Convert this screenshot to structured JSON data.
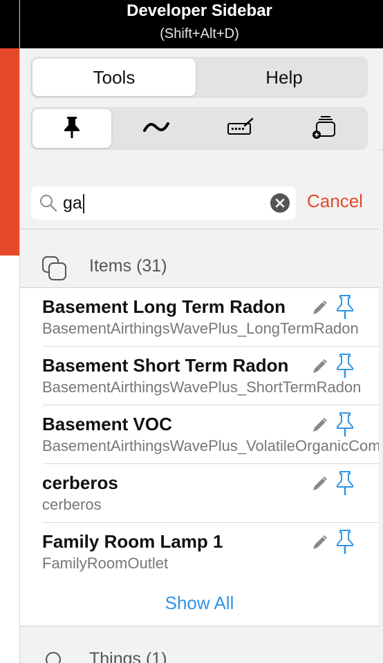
{
  "header": {
    "title": "Developer Sidebar",
    "subtitle": "(Shift+Alt+D)"
  },
  "tabs": {
    "tools_label": "Tools",
    "help_label": "Help",
    "selected": "Tools"
  },
  "modes": [
    {
      "icon": "pin-icon",
      "selected": true
    },
    {
      "icon": "wave-icon",
      "selected": false
    },
    {
      "icon": "keyboard-pen-icon",
      "selected": false
    },
    {
      "icon": "add-window-icon",
      "selected": false
    }
  ],
  "search": {
    "value": "ga",
    "cancel_label": "Cancel"
  },
  "items_section": {
    "header": "Items (31)",
    "icon": "items-stack-icon",
    "rows": [
      {
        "label": "Basement Long Term Radon",
        "sub": "BasementAirthingsWavePlus_LongTermRadon"
      },
      {
        "label": "Basement Short Term Radon",
        "sub": "BasementAirthingsWavePlus_ShortTermRadon"
      },
      {
        "label": "Basement VOC",
        "sub": "BasementAirthingsWavePlus_VolatileOrganicCompounds"
      },
      {
        "label": "cerberos",
        "sub": "cerberos"
      },
      {
        "label": "Family Room Lamp 1",
        "sub": "FamilyRoomOutlet"
      }
    ],
    "show_all_label": "Show All"
  },
  "things_section": {
    "header": "Things (1)",
    "icon": "search-icon"
  },
  "colors": {
    "accent_orange": "#e04a27",
    "link_blue": "#2f94e6",
    "pin_blue": "#2f94e6"
  }
}
